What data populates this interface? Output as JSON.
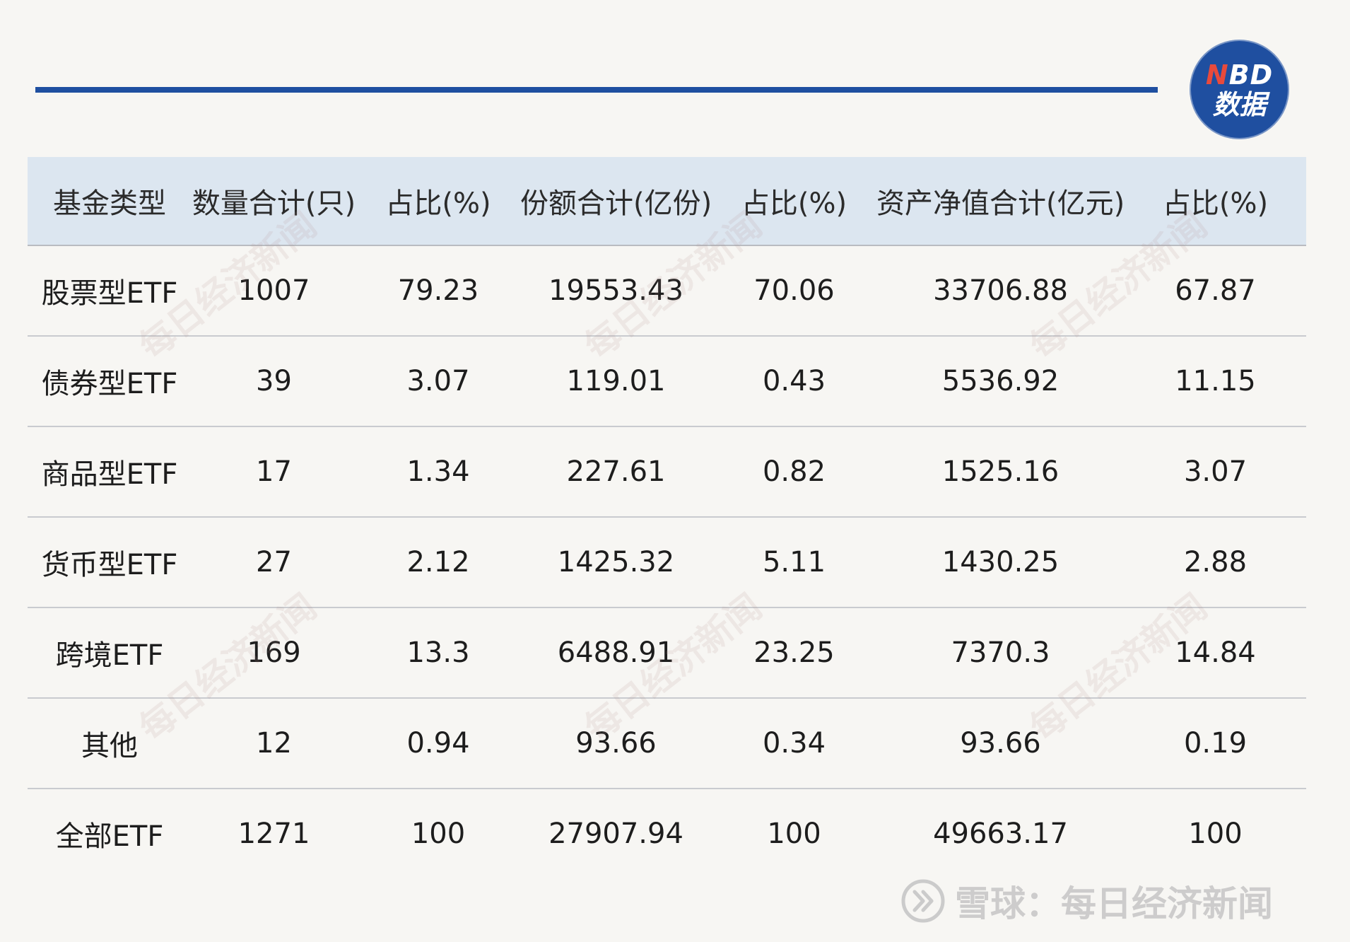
{
  "brand": {
    "logo_line1_first": "N",
    "logo_line1_rest": "BD",
    "logo_line2": "数据",
    "accent_color": "#1f4fa0",
    "logo_red": "#e84a3c"
  },
  "watermark_text": "每日经济新闻",
  "footer": {
    "text": "雪球：每日经济新闻"
  },
  "chart_data": {
    "type": "table",
    "columns": [
      "基金类型",
      "数量合计(只)",
      "占比(%)",
      "份额合计(亿份)",
      "占比(%)",
      "资产净值合计(亿元)",
      "占比(%)"
    ],
    "rows": [
      [
        "股票型ETF",
        "1007",
        "79.23",
        "19553.43",
        "70.06",
        "33706.88",
        "67.87"
      ],
      [
        "债券型ETF",
        "39",
        "3.07",
        "119.01",
        "0.43",
        "5536.92",
        "11.15"
      ],
      [
        "商品型ETF",
        "17",
        "1.34",
        "227.61",
        "0.82",
        "1525.16",
        "3.07"
      ],
      [
        "货币型ETF",
        "27",
        "2.12",
        "1425.32",
        "5.11",
        "1430.25",
        "2.88"
      ],
      [
        "跨境ETF",
        "169",
        "13.3",
        "6488.91",
        "23.25",
        "7370.3",
        "14.84"
      ],
      [
        "其他",
        "12",
        "0.94",
        "93.66",
        "0.34",
        "93.66",
        "0.19"
      ],
      [
        "全部ETF",
        "1271",
        "100",
        "27907.94",
        "100",
        "49663.17",
        "100"
      ]
    ]
  }
}
